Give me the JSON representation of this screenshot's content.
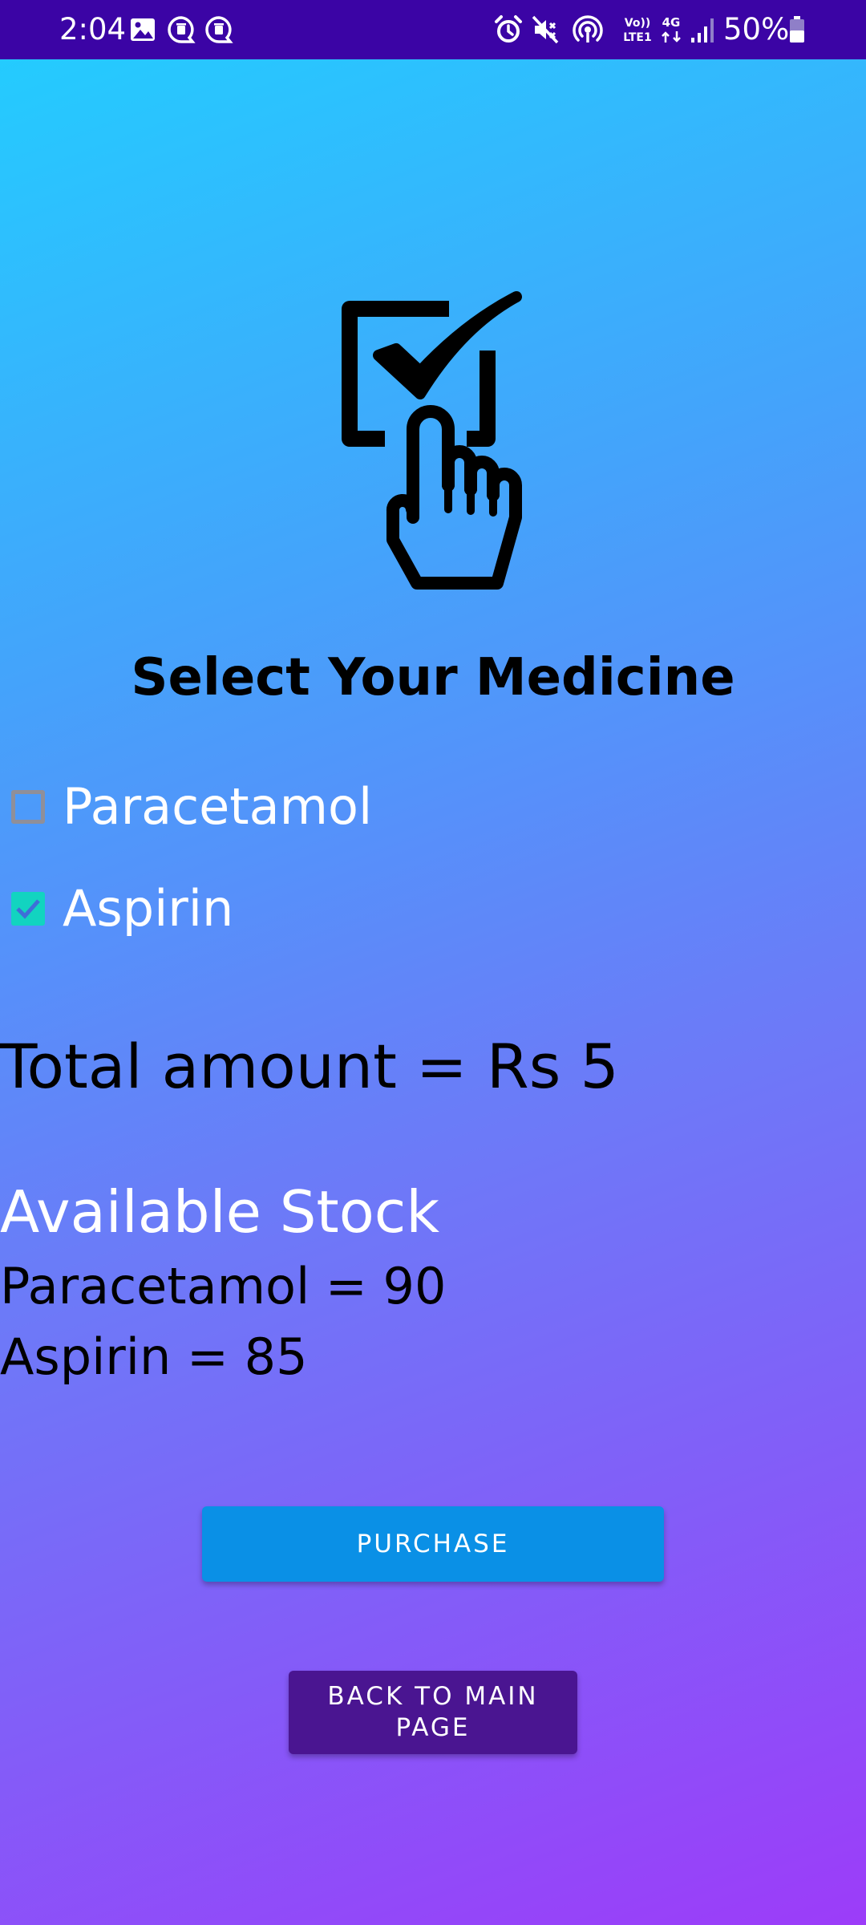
{
  "status_bar": {
    "time": "2:04",
    "battery": "50%",
    "icons": [
      "image-icon",
      "chat-bubble-icon",
      "chat-bubble-icon",
      "alarm-icon",
      "mute-vibrate-icon",
      "hotspot-icon",
      "volte-lte1-icon",
      "4g-data-icon",
      "signal-icon",
      "battery-icon"
    ],
    "volte_label_top": "Vo))",
    "volte_label_bottom": "LTE1",
    "network_label": "4G",
    "background": "#3b04a5"
  },
  "hero": {
    "icon": "checkbox-hand-tap-icon"
  },
  "page_title": "Select Your Medicine",
  "medicines": [
    {
      "label": "Paracetamol",
      "checked": false
    },
    {
      "label": "Aspirin",
      "checked": true
    }
  ],
  "total": "Total amount = Rs 5",
  "stock": {
    "heading": "Available Stock",
    "lines": [
      "Paracetamol = 90",
      "Aspirin = 85"
    ]
  },
  "buttons": {
    "purchase": "PURCHASE",
    "back": "BACK TO MAIN PAGE"
  },
  "colors": {
    "gradient_top": "#21cfff",
    "gradient_bottom": "#9c3cf9",
    "checkbox_checked": "#12d4c0",
    "purchase_button": "#0a90e6",
    "back_button": "#4a1591"
  }
}
